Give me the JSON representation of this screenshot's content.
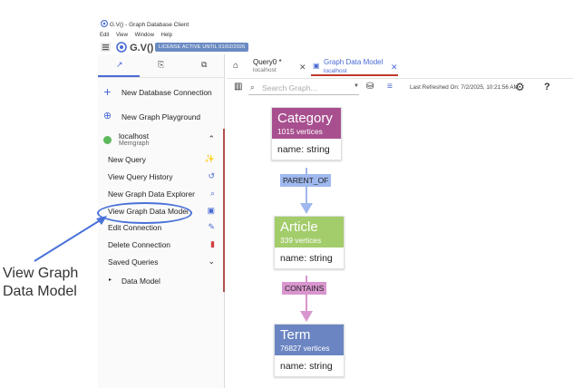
{
  "window": {
    "title": "G.V() - Graph Database Client"
  },
  "menu": [
    "Edit",
    "View",
    "Window",
    "Help"
  ],
  "app": {
    "brand": "G.V()",
    "license": "LICENSE ACTIVE UNTIL 01/02/2026"
  },
  "sidebar": {
    "new_connection": "New Database Connection",
    "playground": "New Graph Playground",
    "connection": {
      "name": "localhost",
      "type": "Memgraph",
      "status_color": "#5cb85c"
    },
    "items": [
      {
        "label": "New Query",
        "icon": "magic-wand-icon"
      },
      {
        "label": "View Query History",
        "icon": "history-icon"
      },
      {
        "label": "New Graph Data Explorer",
        "icon": "explore-icon"
      },
      {
        "label": "View Graph Data Model",
        "icon": "database-icon"
      },
      {
        "label": "Edit Connection",
        "icon": "edit-icon"
      },
      {
        "label": "Delete Connection",
        "icon": "trash-icon"
      }
    ],
    "saved_queries": "Saved Queries",
    "data_model": "Data Model"
  },
  "annotation": {
    "line1": "View Graph",
    "line2": "Data Model",
    "color": "#4a72d8"
  },
  "tabs": [
    {
      "title": "Query0 *",
      "sub": "localhost"
    },
    {
      "title": "Graph Data Model",
      "sub": "localhost"
    }
  ],
  "toolbar": {
    "search_placeholder": "Search Graph...",
    "last_refreshed": "Last Refreshed On: 7/2/2025, 10:21:56 AM",
    "help": "?"
  },
  "graph": {
    "nodes": [
      {
        "name": "Category",
        "count": "1015 vertices",
        "prop": "name: string",
        "color": "#a8508f"
      },
      {
        "name": "Article",
        "count": "339 vertices",
        "prop": "name: string",
        "color": "#a3cc6b"
      },
      {
        "name": "Term",
        "count": "76827 vertices",
        "prop": "name: string",
        "color": "#6b85c2"
      }
    ],
    "edges": [
      {
        "label": "PARENT_OF",
        "color": "#9fb8ee"
      },
      {
        "label": "CONTAINS",
        "color": "#d996ce"
      }
    ]
  }
}
